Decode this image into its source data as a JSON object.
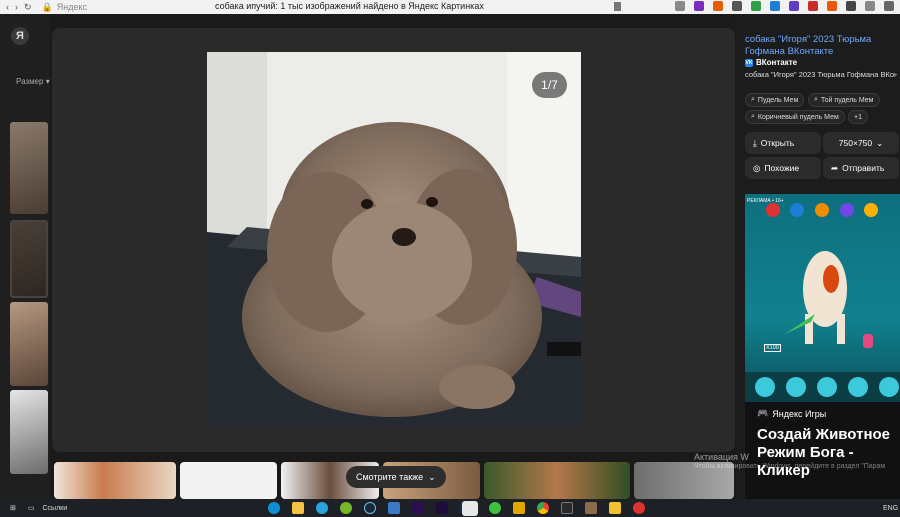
{
  "browser": {
    "site": "Яндекс",
    "title": "собака ипучий: 1 тыс изображений найдено в Яндекс Картинках"
  },
  "sidebar": {
    "logo": "Я",
    "size_filter": "Размер ▾"
  },
  "viewer": {
    "counter": "1/7",
    "see_also": "Смотрите также",
    "see_also_icon": "chevron-down-icon"
  },
  "source": {
    "title": "собака \"Игоря\" 2023 Тюрьма Гофмана ВКонтакте",
    "site": "ВКонтакте",
    "description": "собака \"Игоря\" 2023 Тюрьма Гофмана ВКон..."
  },
  "tags": [
    "Пудель Мем",
    "Той пудель Мем",
    "Коричневый пудель Мем",
    "+1"
  ],
  "actions": {
    "open": "Открыть",
    "size": "750×750",
    "similar": "Похожие",
    "send": "Отправить"
  },
  "ad": {
    "label": "РЕКЛАМА • 16+",
    "counter": "X100",
    "brand": "Яндекс Игры",
    "headline": "Создай Животное Режим Бога - Кликер"
  },
  "watermark": {
    "line1": "Активация W",
    "line2": "Чтобы активировать Windows, перейдите в раздел \"Парам"
  },
  "taskbar": {
    "links": "Ссылки",
    "lang": "ENG"
  },
  "colors": {
    "link": "#6fa8ff",
    "vk": "#2787f5",
    "background": "#1a1a1a"
  }
}
